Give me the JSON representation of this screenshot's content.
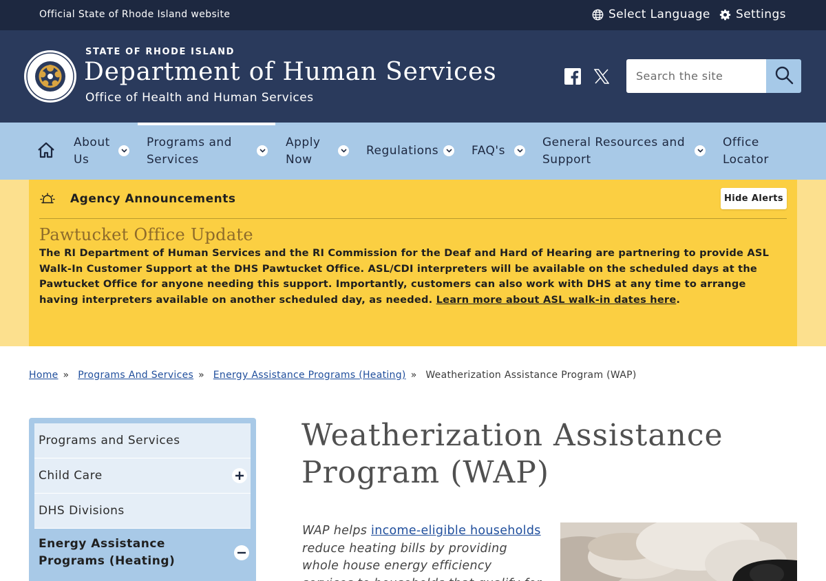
{
  "utility": {
    "official": "Official State of Rhode Island website",
    "language": "Select Language",
    "settings": "Settings"
  },
  "header": {
    "state": "STATE OF RHODE ISLAND",
    "department": "Department of Human Services",
    "office": "Office of Health and Human Services",
    "search_placeholder": "Search the site"
  },
  "nav": {
    "items": [
      {
        "line1": "About",
        "line2": "Us"
      },
      {
        "line1": "Programs and",
        "line2": "Services"
      },
      {
        "line1": "Apply",
        "line2": "Now"
      },
      {
        "line1": "Regulations",
        "line2": ""
      },
      {
        "line1": "FAQ's",
        "line2": ""
      },
      {
        "line1": "General Resources and",
        "line2": "Support"
      },
      {
        "line1": "Office",
        "line2": "Locator"
      }
    ]
  },
  "alerts": {
    "title": "Agency Announcements",
    "hide_label": "Hide Alerts",
    "update_title": "Pawtucket Office Update",
    "message": "The RI Department of Human Services and the RI Commission for the Deaf and Hard of Hearing are partnering to provide ASL Walk-In Customer Support at the DHS Pawtucket Office. ASL/CDI interpreters will be available on the scheduled days at the Pawtucket Office for anyone needing this support. Importantly, customers can also work with DHS at any time to arrange having interpreters available on another scheduled day, as needed. ",
    "link": "Learn more about ASL walk-in dates here",
    "end": "."
  },
  "breadcrumb": {
    "home": "Home",
    "programs": "Programs And Services",
    "energy": "Energy Assistance Programs (Heating)",
    "current": "Weatherization Assistance Program (WAP)",
    "separator": "»"
  },
  "sidebar": {
    "items": [
      {
        "label": "Programs and Services"
      },
      {
        "label": "Child Care"
      },
      {
        "label": "DHS Divisions"
      },
      {
        "label": "Energy Assistance Programs (Heating)"
      }
    ]
  },
  "main": {
    "title": "Weatherization Assistance Program (WAP)",
    "intro_start": "WAP helps ",
    "intro_link": "income-eligible households",
    "intro_rest": " reduce heating bills by providing whole house energy efficiency services to households that qualify for"
  },
  "colors": {
    "utility_bg": "#1d2840",
    "header_bg": "#2a3a5c",
    "nav_bg": "#a8c9e7",
    "alert_bg": "#fbcf42",
    "link": "#1f4e9c"
  }
}
